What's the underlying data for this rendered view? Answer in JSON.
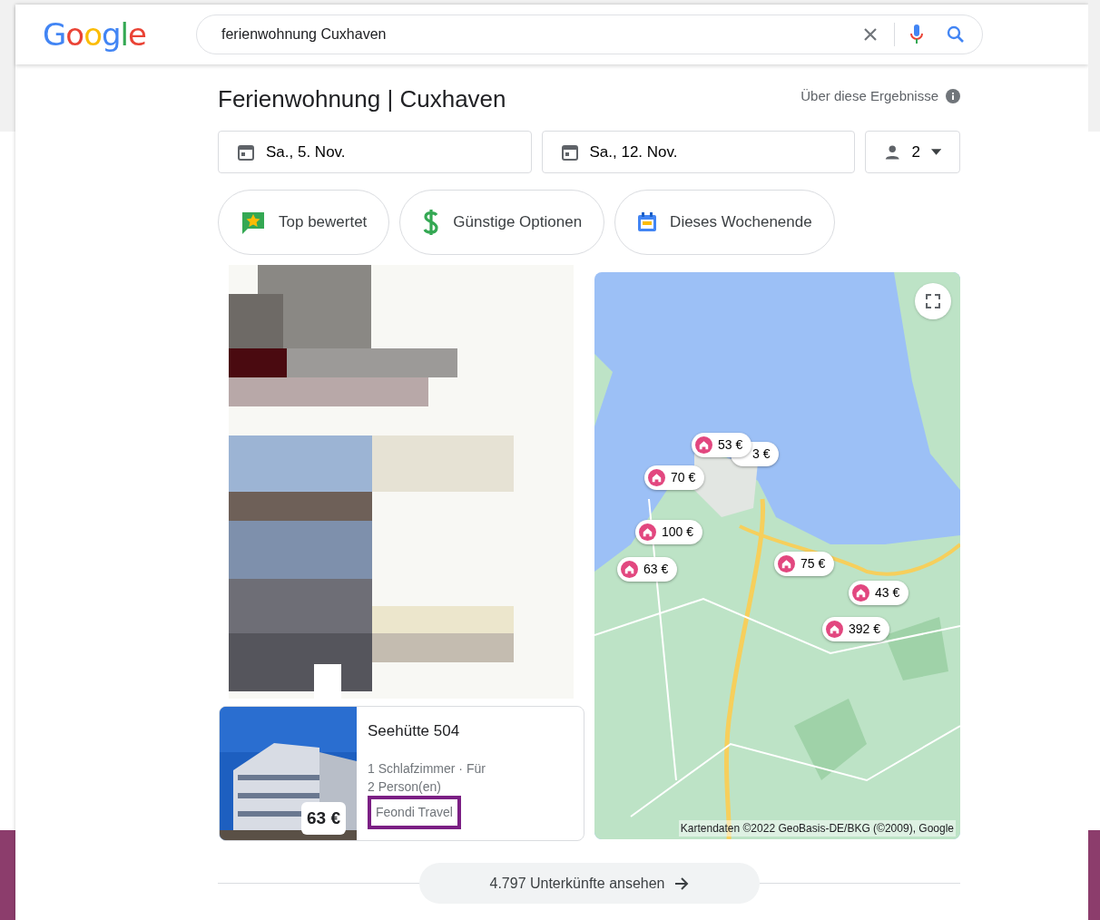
{
  "logo": "Google",
  "search": {
    "value": "ferienwohnung Cuxhaven"
  },
  "title": "Ferienwohnung | Cuxhaven",
  "about_link": "Über diese Ergebnisse",
  "dates": [
    {
      "label": "Sa., 5. Nov."
    },
    {
      "label": "Sa., 12. Nov."
    }
  ],
  "guests": "2",
  "filters": [
    {
      "kind": "star",
      "label": "Top bewertet"
    },
    {
      "kind": "dollar",
      "label": "Günstige Optionen"
    },
    {
      "kind": "calendar",
      "label": "Dieses Wochenende"
    }
  ],
  "listing": {
    "name": "Seehütte 504",
    "details": "1 Schlafzimmer · Für 2 Person(en)",
    "provider": "Feondi Travel",
    "price": "63 €",
    "highlighted": true
  },
  "map": {
    "pins": [
      {
        "price": "3 €"
      },
      {
        "price": "53 €"
      },
      {
        "price": "70 €"
      },
      {
        "price": "100 €"
      },
      {
        "price": "63 €"
      },
      {
        "price": "75 €"
      },
      {
        "price": "43 €"
      },
      {
        "price": "392 €"
      }
    ],
    "attribution": "Kartendaten ©2022 GeoBasis-DE/BKG (©2009), Google"
  },
  "more_button": "4.797 Unterkünfte ansehen"
}
